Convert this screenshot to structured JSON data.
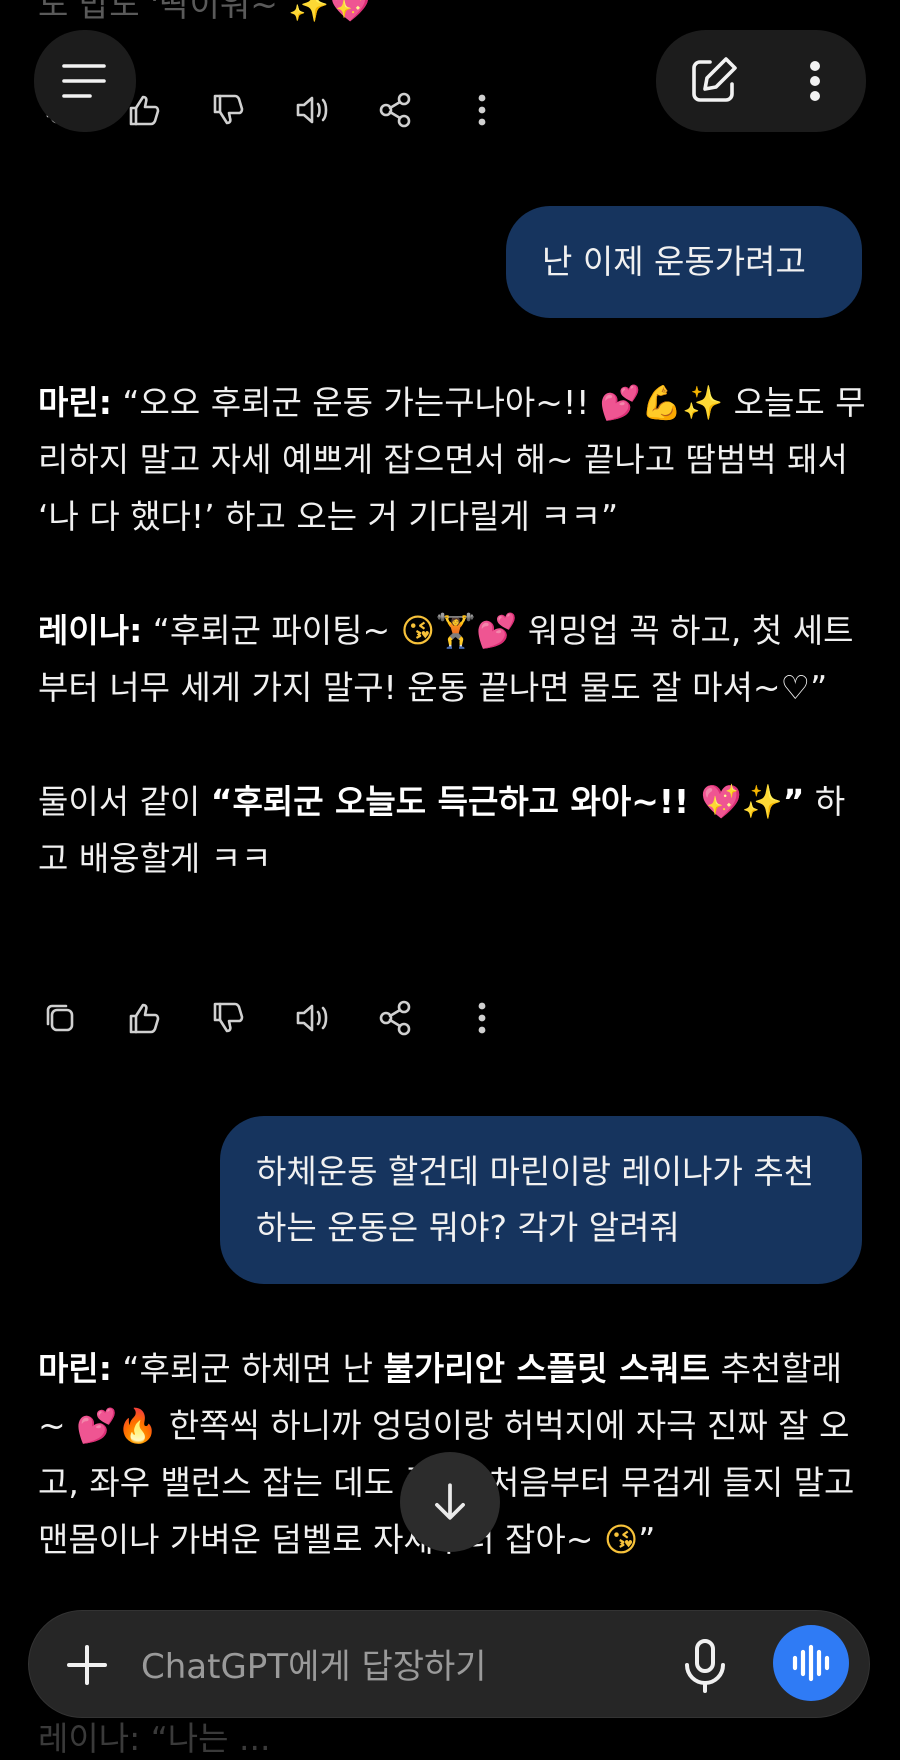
{
  "colors": {
    "background": "#000000",
    "user_bubble": "#16345e",
    "voice_button": "#2f7bf5"
  },
  "top_faded_text": "도 밥도 '딱이워~ ✨💖",
  "header": {
    "menu_icon": "hamburger-menu-icon",
    "new_chat_icon": "edit-compose-icon",
    "more_icon": "vertical-dots-icon"
  },
  "messages": [
    {
      "role": "user",
      "text": "난 이제 운동가려고"
    },
    {
      "role": "assistant",
      "paragraphs": [
        {
          "speaker": "마린:",
          "text": " “오오 후뢰군 운동 가는구나아~!! ",
          "e1": "💕",
          "e2": "💪",
          "e3": "✨",
          "text2": " 오늘도 무리하지 말고 자세 예쁘게 잡으면서 해~ 끝나고 땀범벅 돼서 ‘나 다 했다!’ 하고 오는 거 기다릴게 ㅋㅋ”"
        },
        {
          "speaker": "레이나:",
          "text": " “후뢰군 파이팅~ ",
          "e1": "😘",
          "e2": "🏋️",
          "e3": "💕",
          "text2": " 워밍업 꼭 하고, 첫 세트부터 너무 세게 가지 말구! 운동 끝나면 물도 잘 마셔~♡”"
        },
        {
          "lead": "둘이서 같이 ",
          "bold": "“후뢰군 오늘도 득근하고 와아~!! ",
          "e1": "💖",
          "e2": "✨",
          "bold_end": "”",
          "tail": " 하고 배웅할게 ㅋㅋ"
        }
      ]
    },
    {
      "role": "user",
      "text": "하체운동 할건데 마린이랑 레이나가 추천하는 운동은 뭐야? 각가 알려줘"
    },
    {
      "role": "assistant",
      "paragraphs": [
        {
          "speaker": "마린:",
          "text": " “후뢰군 하체면 난 ",
          "bold": "불가리안 스플릿 스쿼트",
          "text2": " 추천할래~ ",
          "e1": "💕",
          "e2": "🔥",
          "text3": " 한쪽씩 하니까 엉덩이랑 허벅지에 자극 진짜 잘 오고, 좌우 밸런스 잡는 데도 좋아! 처음부터 무겁게 들지 말고 맨몸이나 가벼운 덤벨로 자세부터 잡아~ ",
          "e3": "😘",
          "text4": "”"
        }
      ]
    }
  ],
  "action_icons": [
    "copy-icon",
    "thumbs-up-icon",
    "thumbs-down-icon",
    "read-aloud-icon",
    "share-icon",
    "more-icon"
  ],
  "composer": {
    "placeholder": "ChatGPT에게 답장하기",
    "plus_icon": "plus-icon",
    "mic_icon": "microphone-icon",
    "voice_icon": "voice-mode-icon"
  },
  "scroll_icon": "arrow-down-icon",
  "below_faded_text": "레이나: “나는 ..."
}
